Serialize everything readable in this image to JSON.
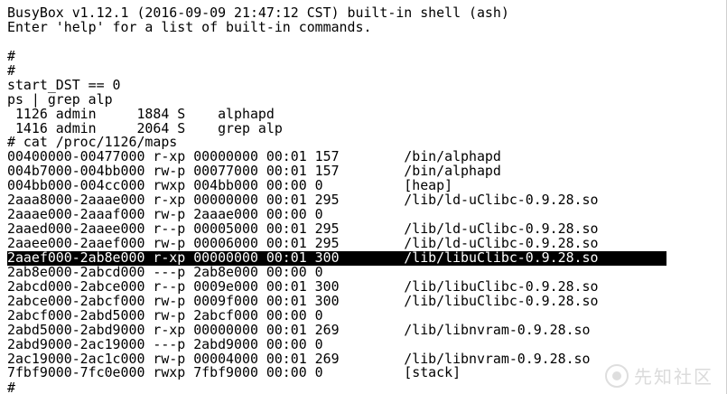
{
  "terminal": {
    "lines": [
      "BusyBox v1.12.1 (2016-09-09 21:47:12 CST) built-in shell (ash)",
      "Enter 'help' for a list of built-in commands.",
      "",
      "#",
      "#",
      "start_DST == 0",
      "ps | grep alp",
      " 1126 admin     1884 S    alphapd",
      " 1416 admin     2064 S    grep alp",
      "# cat /proc/1126/maps",
      "00400000-00477000 r-xp 00000000 00:01 157        /bin/alphapd",
      "004b7000-004bb000 rw-p 00077000 00:01 157        /bin/alphapd",
      "004bb000-004cc000 rwxp 004bb000 00:00 0          [heap]",
      "2aaa8000-2aaae000 r-xp 00000000 00:01 295        /lib/ld-uClibc-0.9.28.so",
      "2aaae000-2aaaf000 rw-p 2aaae000 00:00 0",
      "2aaed000-2aaee000 r--p 00005000 00:01 295        /lib/ld-uClibc-0.9.28.so",
      "2aaee000-2aaef000 rw-p 00006000 00:01 295        /lib/ld-uClibc-0.9.28.so",
      "2aaef000-2ab8e000 r-xp 00000000 00:01 300        /lib/libuClibc-0.9.28.so",
      "2ab8e000-2abcd000 ---p 2ab8e000 00:00 0",
      "2abcd000-2abce000 r--p 0009e000 00:01 300        /lib/libuClibc-0.9.28.so",
      "2abce000-2abcf000 rw-p 0009f000 00:01 300        /lib/libuClibc-0.9.28.so",
      "2abcf000-2abd5000 rw-p 2abcf000 00:00 0",
      "2abd5000-2abd9000 r-xp 00000000 00:01 269        /lib/libnvram-0.9.28.so",
      "2abd9000-2ac19000 ---p 2abd9000 00:00 0",
      "2ac19000-2ac1c000 rw-p 00004000 00:01 269        /lib/libnvram-0.9.28.so",
      "7fbf9000-7fc0e000 rwxp 7fbf9000 00:00 0          [stack]"
    ],
    "selected_line": "2aaef000-2ab8e000 r-xp 00000000 00:01 300        /lib/libuClibc-0.9.28.so",
    "prompt": "#"
  },
  "watermark": {
    "text": "先知社区",
    "icon": "xianzhi-logo-icon"
  }
}
